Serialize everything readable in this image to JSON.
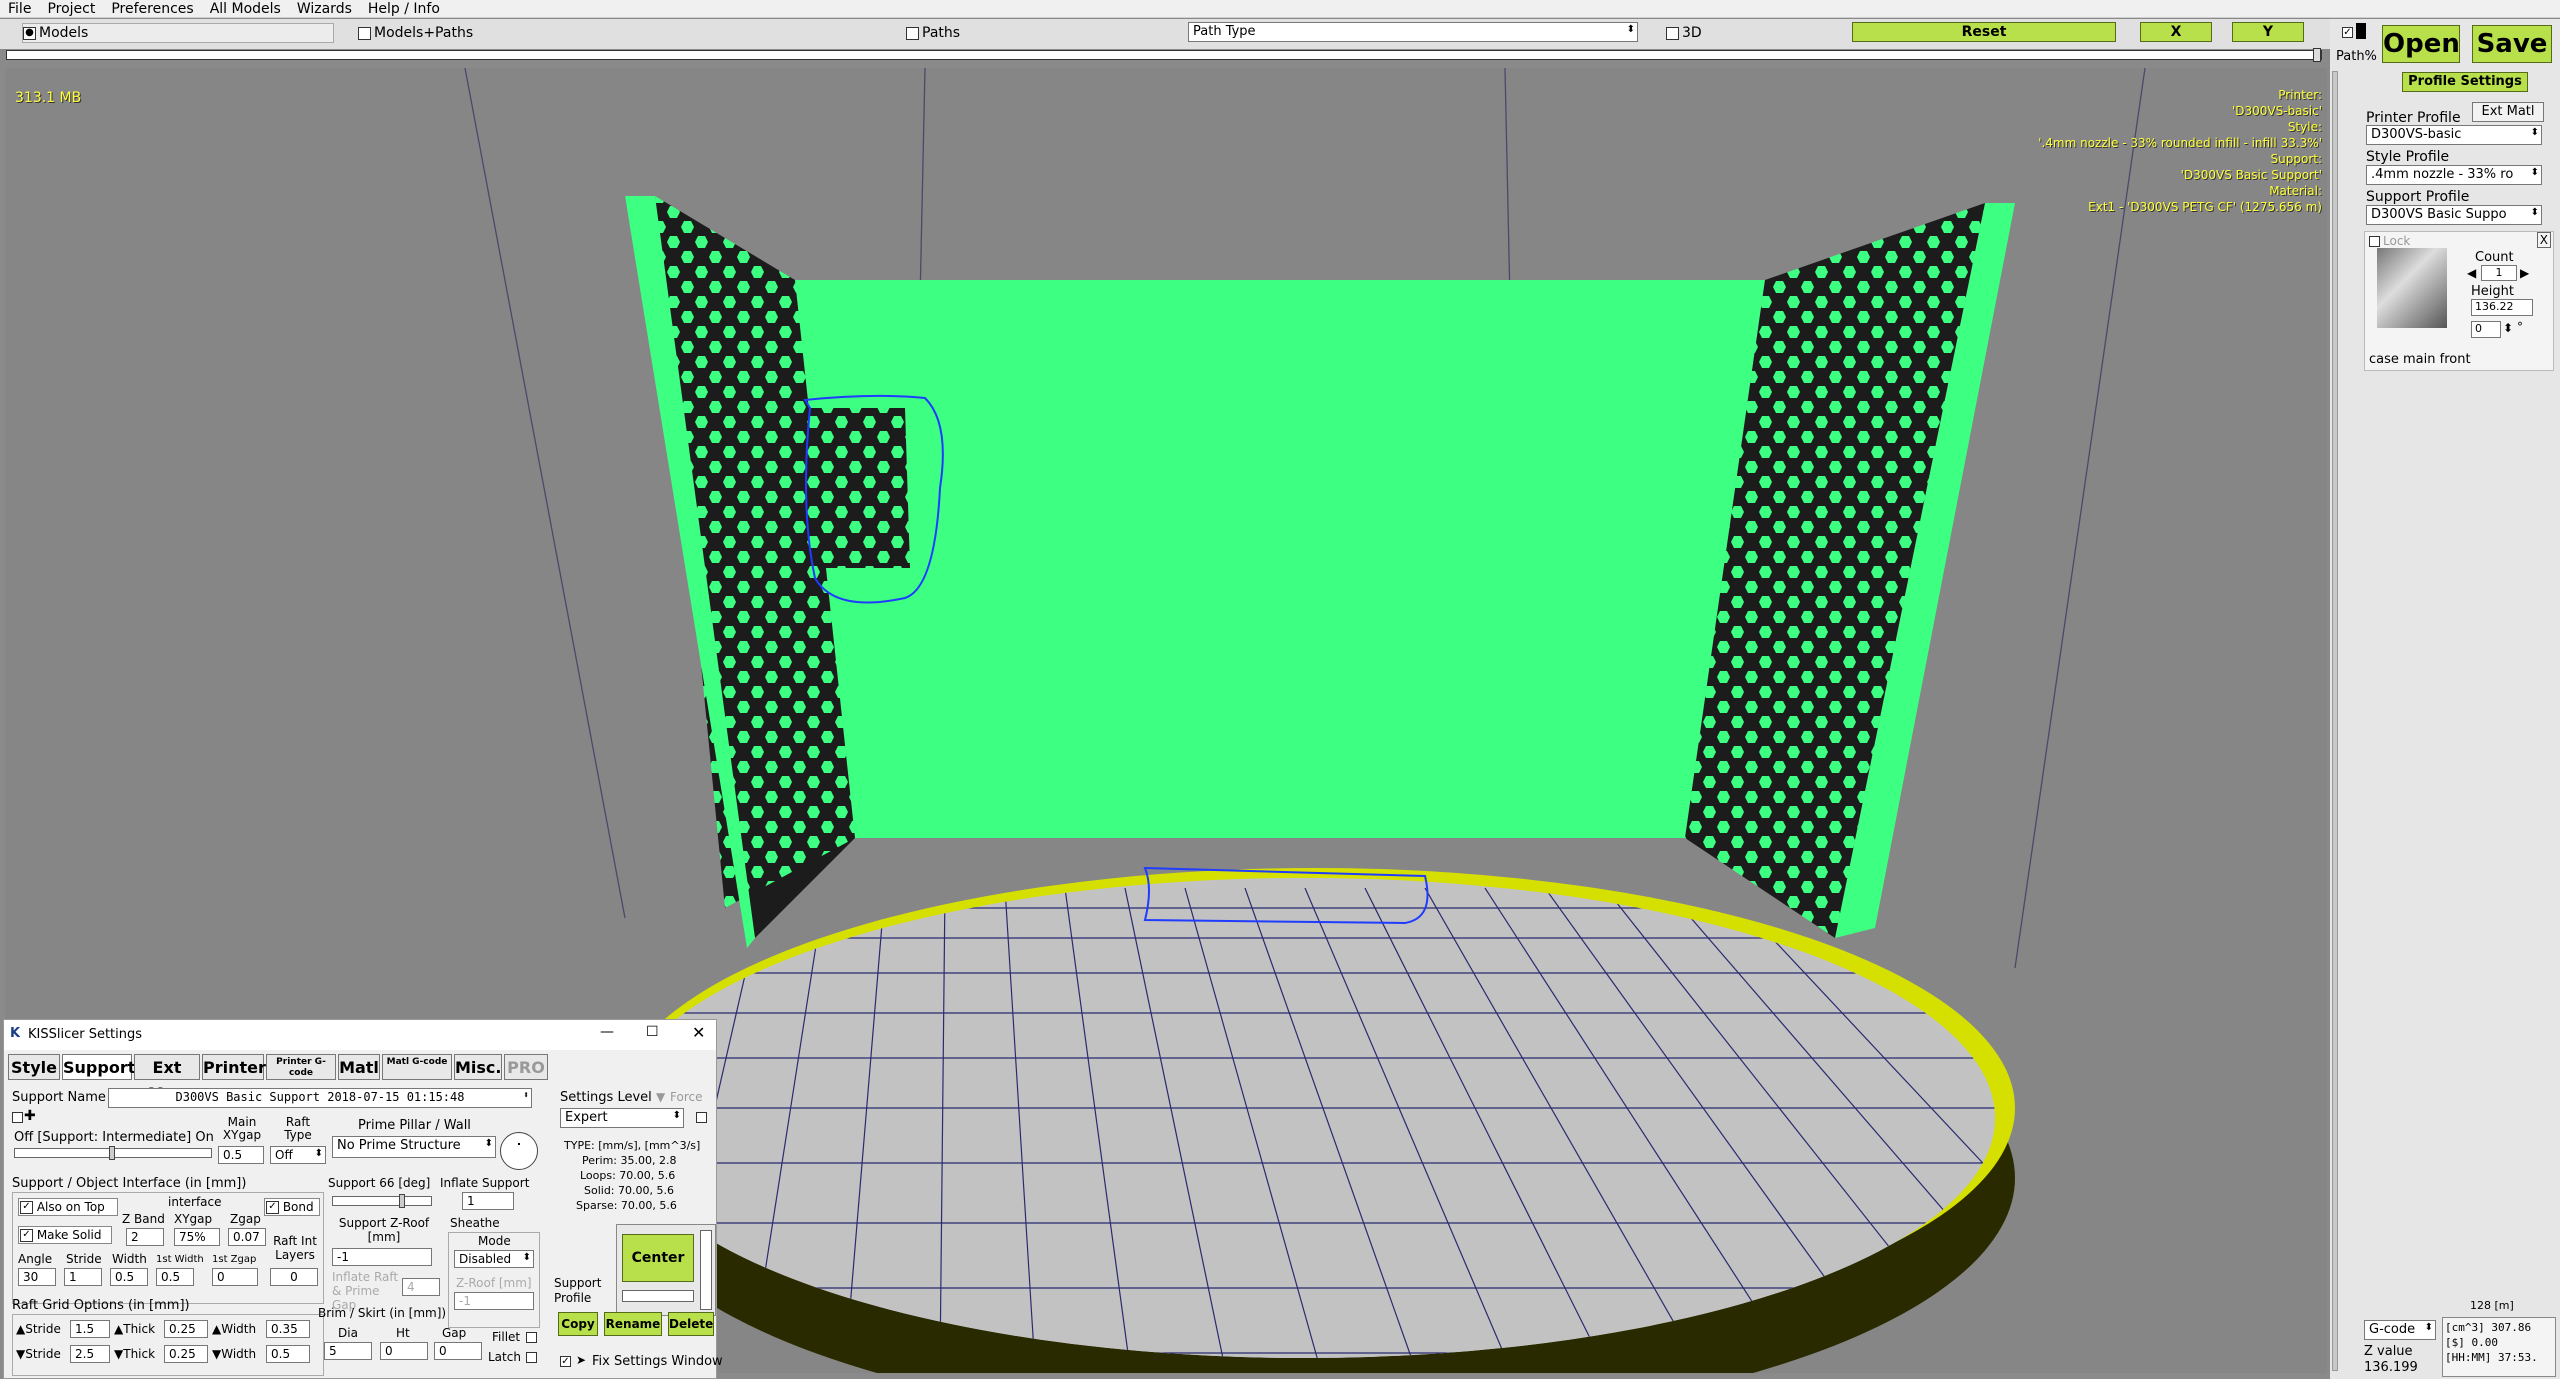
{
  "menu": [
    "File",
    "Project",
    "Preferences",
    "All Models",
    "Wizards",
    "Help / Info"
  ],
  "toolbar": {
    "models_label": "Models",
    "models_paths_label": "Models+Paths",
    "paths_label": "Paths",
    "path_type_value": "Path Type",
    "three_d_label": "3D",
    "reset_label": "Reset",
    "x_label": "X",
    "y_label": "Y",
    "path_percent_label": "Path%",
    "open_label": "Open",
    "save_label": "Save",
    "profile_settings_label": "Profile Settings"
  },
  "viewport": {
    "memory": "313.1 MB",
    "info_lines": [
      "Printer:",
      "'D300VS-basic'",
      "Style:",
      "'.4mm nozzle - 33% rounded infill - infill 33.3%'",
      "Support:",
      "'D300VS Basic Support'",
      "Material:",
      "Ext1 - 'D300VS PETG CF' (1275.656 m)"
    ],
    "scale_label": "128 [m]"
  },
  "right_panel": {
    "printer_profile_label": "Printer Profile",
    "ext_matl_label": "Ext Matl",
    "printer_profile_value": "D300VS-basic",
    "style_profile_label": "Style Profile",
    "style_profile_value": ".4mm nozzle - 33% ro",
    "support_profile_label": "Support Profile",
    "support_profile_value": "D300VS Basic Suppo",
    "lock_label": "Lock",
    "close_x": "X",
    "count_label": "Count",
    "count_value": "1",
    "height_label": "Height",
    "height_value": "136.22",
    "rotation_value": "0",
    "degree_symbol": "°",
    "model_name": "case main front",
    "gcode_select": "G-code",
    "stats_line1": "[cm^3]  307.86",
    "stats_line2": "[$]  0.00",
    "stats_line3": "[HH:MM]  37:53.",
    "z_value_label": "Z value",
    "z_value": "136.199"
  },
  "settings": {
    "title": "KISSlicer Settings",
    "tabs": [
      "Style",
      "Support",
      "Ext Map",
      "Printer",
      "Printer G-code",
      "Matl",
      "Matl G-code",
      "Misc.",
      "PRO"
    ],
    "support_name_label": "Support Name",
    "support_name_value": "D300VS Basic Support  2018-07-15 01:15:48",
    "off_support_label": "Off [Support: Intermediate] On",
    "main_xygap_label": "Main XYgap",
    "main_xygap_value": "0.5",
    "raft_type_label": "Raft Type",
    "raft_type_value": "Off",
    "prime_pillar_label": "Prime Pillar / Wall",
    "prime_pillar_value": "No Prime Structure",
    "interface_header": "Support / Object Interface (in [mm])",
    "also_on_top": "Also on Top",
    "interface_label": "interface",
    "bond_label": "Bond",
    "make_solid": "Make Solid",
    "zband_label": "Z Band",
    "zband_value": "2",
    "xygap_label": "XYgap",
    "xygap_value": "75%",
    "zgap_label": "Zgap",
    "zgap_value": "0.07",
    "angle_label": "Angle",
    "angle_value": "30",
    "stride_label": "Stride",
    "stride_value": "1",
    "width_label": "Width",
    "width_value": "0.5",
    "first_width_label": "1st Width",
    "first_width_value": "0.5",
    "first_zgap_label": "1st Zgap",
    "first_zgap_value": "0",
    "raft_int_layers_label": "Raft Int Layers",
    "raft_int_layers_value": "0",
    "support_deg_label": "Support 66 [deg]",
    "inflate_support_label": "Inflate Support",
    "inflate_support_value": "1",
    "support_zroof_label": "Support Z-Roof [mm]",
    "support_zroof_value": "-1",
    "sheathe_label": "Sheathe",
    "mode_label": "Mode",
    "mode_value": "Disabled",
    "zroof_small_label": "Z-Roof [mm]",
    "zroof_small_value": "-1",
    "inflate_raft_label": "Inflate Raft & Prime Gap",
    "inflate_raft_value": "4",
    "raft_grid_header": "Raft Grid Options (in [mm])",
    "stride_up_label": "Stride",
    "stride_up_value": "1.5",
    "thick_up_label": "Thick",
    "thick_up_value": "0.25",
    "width_up_label": "Width",
    "width_up_value": "0.35",
    "stride_dn_label": "Stride",
    "stride_dn_value": "2.5",
    "thick_dn_label": "Thick",
    "thick_dn_value": "0.25",
    "width_dn_label": "Width",
    "width_dn_value": "0.5",
    "brim_header": "Brim / Skirt (in [mm])",
    "dia_label": "Dia",
    "dia_value": "5",
    "ht_label": "Ht",
    "ht_value": "0",
    "gap_label": "Gap",
    "gap_value": "0",
    "fillet_label": "Fillet",
    "latch_label": "Latch",
    "settings_level_label": "Settings Level",
    "force_label": "Force",
    "settings_level_value": "Expert",
    "type_header": "TYPE: [mm/s], [mm^3/s]",
    "perim_line": "Perim:  35.00,  2.8",
    "loops_line": "Loops:  70.00,  5.6",
    "solid_line": "Solid:  70.00,  5.6",
    "sparse_line": "Sparse:  70.00,  5.6",
    "center_label": "Center",
    "support_profile_label": "Support Profile",
    "copy_label": "Copy",
    "rename_label": "Rename",
    "delete_label": "Delete",
    "fix_settings_label": "Fix Settings Window"
  },
  "colors": {
    "model_green": "#3dff82",
    "bed_yellow": "#d6e000",
    "button_green": "#b8e04a",
    "hud_yellow": "#ffff3a"
  }
}
